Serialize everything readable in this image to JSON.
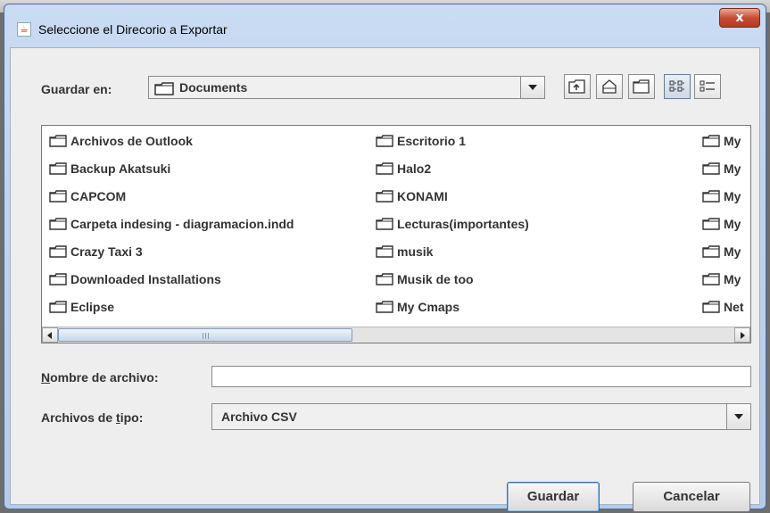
{
  "window": {
    "title": "Seleccione el Direcorio a Exportar",
    "close_label": "x"
  },
  "look_in": {
    "label": "Guardar en:",
    "value": "Documents"
  },
  "toolbar": {
    "buttons": [
      {
        "name": "up-folder-icon"
      },
      {
        "name": "home-folder-icon"
      },
      {
        "name": "new-folder-icon"
      },
      {
        "name": "list-view-icon",
        "active": true
      },
      {
        "name": "details-view-icon"
      }
    ]
  },
  "files": {
    "col1": [
      "Archivos de Outlook",
      "Backup Akatsuki",
      "CAPCOM",
      "Carpeta indesing - diagramacion.indd",
      "Crazy Taxi 3",
      "Downloaded Installations",
      "Eclipse"
    ],
    "col2": [
      "Escritorio 1",
      "Halo2",
      "KONAMI",
      "Lecturas(importantes)",
      "musik",
      "Musik de too",
      "My Cmaps"
    ],
    "col3": [
      "My",
      "My",
      "My",
      "My",
      "My",
      "My",
      "Net"
    ]
  },
  "filename": {
    "label_prefix": "N",
    "label_rest": "ombre de archivo:",
    "value": ""
  },
  "filetype": {
    "label_prefix": "Archivos de ",
    "label_u": "t",
    "label_rest": "ipo:",
    "value": "Archivo CSV"
  },
  "buttons": {
    "save": "Guardar",
    "cancel": "Cancelar"
  }
}
